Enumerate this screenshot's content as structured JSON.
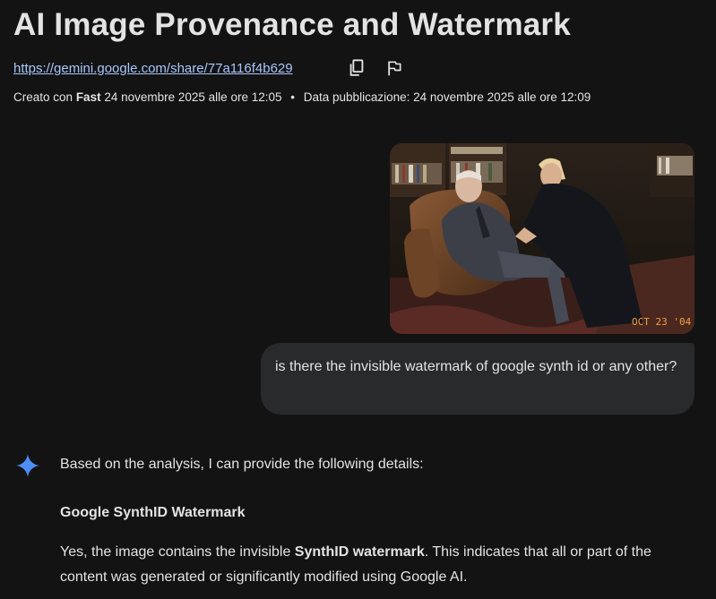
{
  "page": {
    "title": "AI Image Provenance and Watermark",
    "share_url": "https://gemini.google.com/share/77a116f4b629",
    "meta": {
      "created_label": "Creato con",
      "model": "Fast",
      "created_date": "24 novembre 2025 alle ore 12:05",
      "separator": "•",
      "published_label": "Data pubblicazione:",
      "published_date": "24 novembre 2025 alle ore 12:09"
    }
  },
  "icons": {
    "copy": "copy-icon",
    "flag": "flag-icon",
    "gemini": "gemini-spark-icon"
  },
  "user_message": {
    "photo_date_stamp": "OCT 23 '04",
    "text": "is there the invisible watermark of google synth id or any other?"
  },
  "response": {
    "intro": "Based on the analysis, I can provide the following details:",
    "heading": "Google SynthID Watermark",
    "para_before": "Yes, the image contains the invisible ",
    "para_bold": "SynthID watermark",
    "para_after": ". This indicates that all or part of the content was generated or significantly modified using Google AI."
  },
  "colors": {
    "background": "#131314",
    "text": "#e3e3e3",
    "link": "#a8c7fa",
    "bubble": "#282a2c",
    "spark_blue": "#4c8df6",
    "date_stamp": "#f0a040"
  }
}
